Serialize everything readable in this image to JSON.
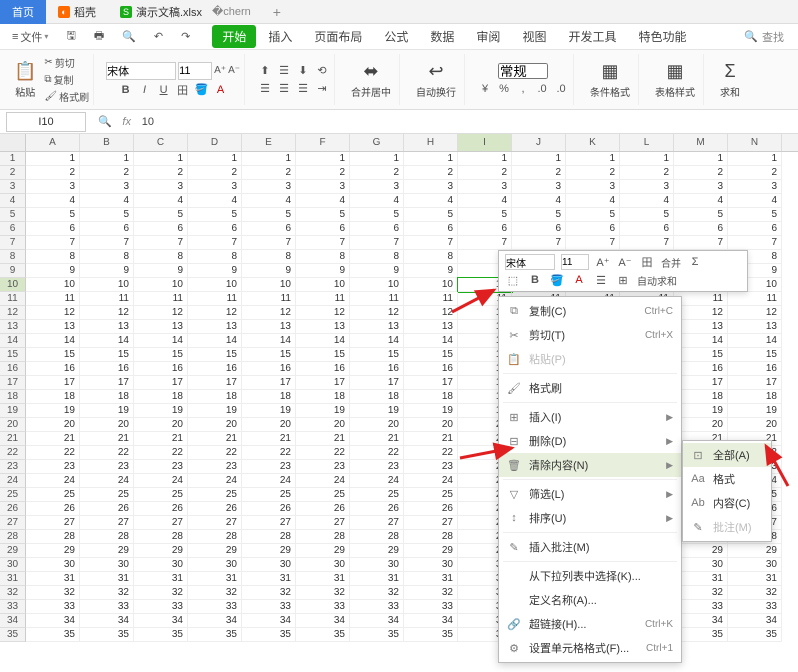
{
  "title_tabs": {
    "home": "首页",
    "doker": "稻壳",
    "sheet": "演示文稿.xlsx"
  },
  "quick": {
    "file": "文件"
  },
  "ribbon_tabs": [
    "开始",
    "插入",
    "页面布局",
    "公式",
    "数据",
    "审阅",
    "视图",
    "开发工具",
    "特色功能"
  ],
  "search_placeholder": "查找",
  "ribbon": {
    "paste": "粘贴",
    "cut": "剪切",
    "copy": "复制",
    "fmtpaint": "格式刷",
    "font": "宋体",
    "fontsize": "11",
    "merge": "合并居中",
    "wrap": "自动换行",
    "numfmt": "常规",
    "condfmt": "条件格式",
    "tablestyle": "表格样式",
    "sum": "求和"
  },
  "namebox": "I10",
  "formula": "10",
  "cols": [
    "A",
    "B",
    "C",
    "D",
    "E",
    "F",
    "G",
    "H",
    "I",
    "J",
    "K",
    "L",
    "M",
    "N"
  ],
  "rows": 35,
  "sel": {
    "row": 10,
    "col": 9
  },
  "mini": {
    "font": "宋体",
    "size": "11",
    "merge": "合并",
    "sum": "自动求和"
  },
  "ctx": [
    {
      "icon": "⧉",
      "label": "复制(C)",
      "sc": "Ctrl+C"
    },
    {
      "icon": "✂",
      "label": "剪切(T)",
      "sc": "Ctrl+X"
    },
    {
      "icon": "📋",
      "label": "粘贴(P)",
      "disabled": true
    },
    {
      "sep": true
    },
    {
      "icon": "🖌",
      "label": "格式刷"
    },
    {
      "sep": true
    },
    {
      "icon": "⊞",
      "label": "插入(I)",
      "sub": true
    },
    {
      "icon": "⊟",
      "label": "删除(D)",
      "sub": true
    },
    {
      "icon": "🗑",
      "label": "清除内容(N)",
      "sub": true,
      "hover": true
    },
    {
      "sep": true
    },
    {
      "icon": "▽",
      "label": "筛选(L)",
      "sub": true
    },
    {
      "icon": "↕",
      "label": "排序(U)",
      "sub": true
    },
    {
      "sep": true
    },
    {
      "icon": "✎",
      "label": "插入批注(M)"
    },
    {
      "sep": true
    },
    {
      "icon": "",
      "label": "从下拉列表中选择(K)..."
    },
    {
      "icon": "",
      "label": "定义名称(A)..."
    },
    {
      "icon": "🔗",
      "label": "超链接(H)...",
      "sc": "Ctrl+K"
    },
    {
      "icon": "⚙",
      "label": "设置单元格格式(F)...",
      "sc": "Ctrl+1"
    }
  ],
  "submenu": [
    {
      "icon": "⊡",
      "label": "全部(A)",
      "hover": true
    },
    {
      "icon": "Aa",
      "label": "格式"
    },
    {
      "icon": "Ab",
      "label": "内容(C)"
    },
    {
      "icon": "✎",
      "label": "批注(M)",
      "disabled": true
    }
  ]
}
